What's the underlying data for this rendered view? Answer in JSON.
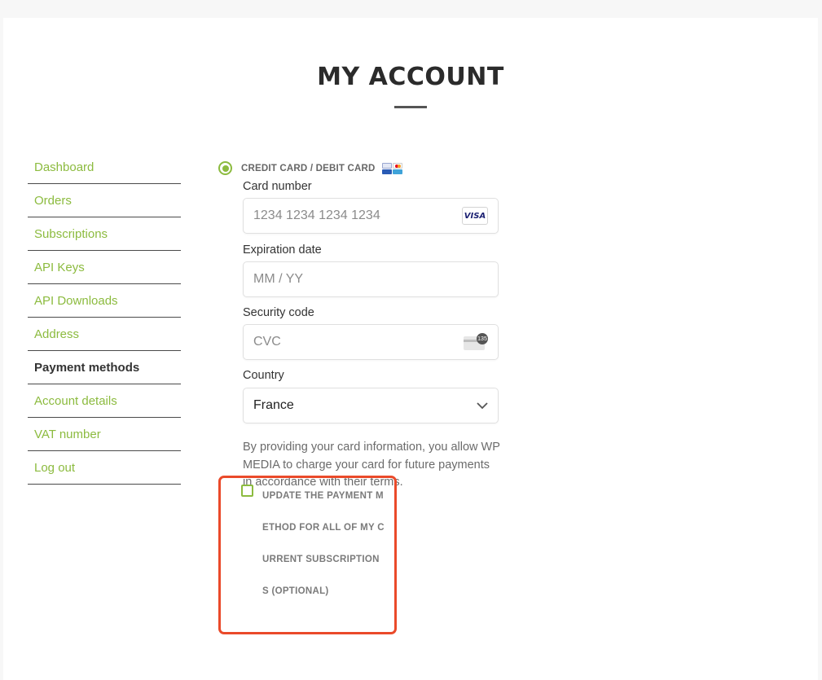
{
  "page": {
    "title": "MY ACCOUNT"
  },
  "nav": {
    "items": [
      {
        "label": "Dashboard",
        "active": false
      },
      {
        "label": "Orders",
        "active": false
      },
      {
        "label": "Subscriptions",
        "active": false
      },
      {
        "label": "API Keys",
        "active": false
      },
      {
        "label": "API Downloads",
        "active": false
      },
      {
        "label": "Address",
        "active": false
      },
      {
        "label": "Payment methods",
        "active": true
      },
      {
        "label": "Account details",
        "active": false
      },
      {
        "label": "VAT number",
        "active": false
      },
      {
        "label": "Log out",
        "active": false
      }
    ]
  },
  "payment": {
    "method_label": "CREDIT CARD / DEBIT CARD",
    "card_number": {
      "label": "Card number",
      "placeholder": "1234 1234 1234 1234",
      "brand": "VISA"
    },
    "expiration": {
      "label": "Expiration date",
      "placeholder": "MM / YY"
    },
    "security": {
      "label": "Security code",
      "placeholder": "CVC",
      "icon_text": "135"
    },
    "country": {
      "label": "Country",
      "value": "France"
    },
    "terms": "By providing your card information, you allow WP MEDIA to charge your card for future payments in accordance with their terms.",
    "update_all_label": "UPDATE THE PAYMENT METHOD FOR ALL OF MY CURRENT SUBSCRIPTIONS (OPTIONAL)"
  },
  "colors": {
    "accent": "#8cbb3f",
    "highlight": "#ea4a2a",
    "title": "#2b2b2b"
  }
}
